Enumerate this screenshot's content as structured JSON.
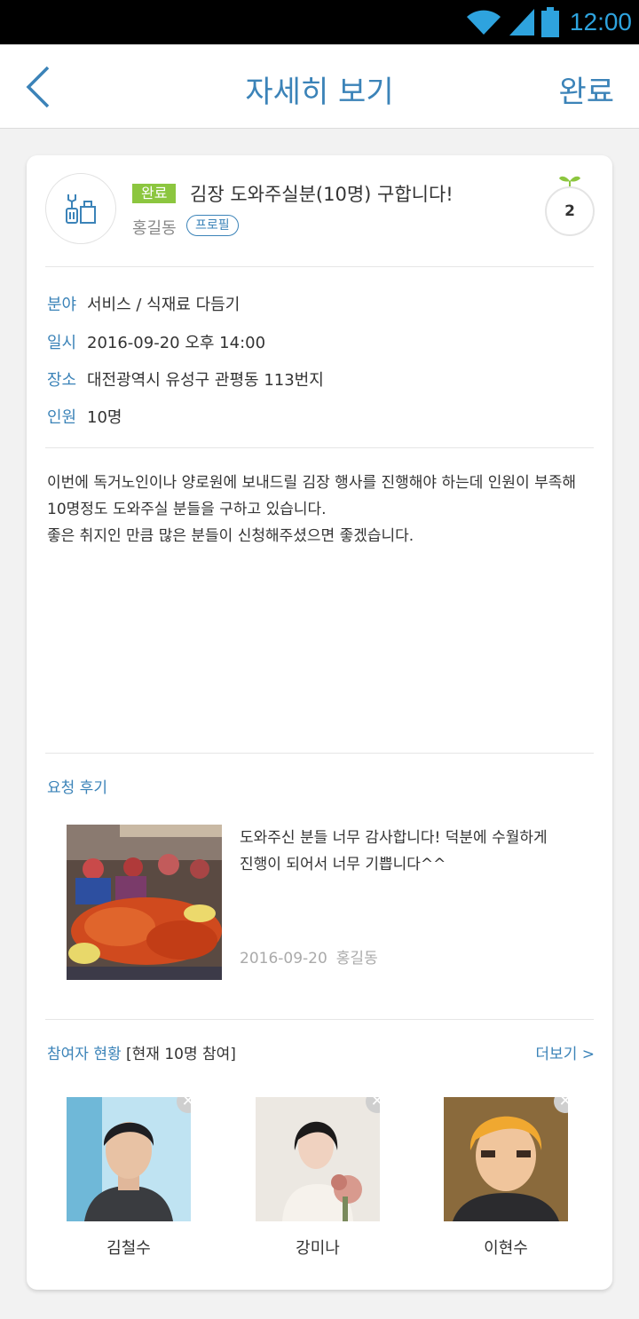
{
  "status_bar": {
    "time": "12:00",
    "icons": [
      "wifi-icon",
      "signal-icon",
      "battery-icon"
    ]
  },
  "header": {
    "back_icon": "chevron-left-icon",
    "title": "자세히 보기",
    "done_label": "완료"
  },
  "post": {
    "category_icon": "tools-icon",
    "status_badge": "완료",
    "title": "김장 도와주실분(10명) 구합니다!",
    "author": "홍길동",
    "profile_label": "프로필",
    "like_count": "2",
    "details": [
      {
        "label": "분야",
        "value": "서비스 / 식재료 다듬기"
      },
      {
        "label": "일시",
        "value": "2016-09-20 오후 14:00"
      },
      {
        "label": "장소",
        "value": "대전광역시 유성구 관평동 113번지"
      },
      {
        "label": "인원",
        "value": "10명"
      }
    ],
    "description": [
      "이번에 독거노인이나 양로원에 보내드릴 김장 행사를 진행해야 하는데 인원이 부족해",
      "10명정도 도와주실 분들을 구하고 있습니다.",
      "좋은 취지인 만큼 많은 분들이 신청해주셨으면 좋겠습니다."
    ]
  },
  "review": {
    "section_title": "요청 후기",
    "text_lines": [
      "도와주신 분들 너무 감사합니다! 덕분에 수월하게",
      "진행이 되어서 너무 기쁩니다^^"
    ],
    "date": "2016-09-20",
    "author": "홍길동"
  },
  "participants": {
    "section_title": "참여자 현황",
    "count_label": "[현재 10명 참여]",
    "more_label": "더보기 >",
    "people": [
      {
        "name": "김철수"
      },
      {
        "name": "강미나"
      },
      {
        "name": "이현수"
      }
    ]
  },
  "colors": {
    "accent": "#3b83b8",
    "status_done": "#8cc63f",
    "status_bar_text": "#2ea3de"
  }
}
